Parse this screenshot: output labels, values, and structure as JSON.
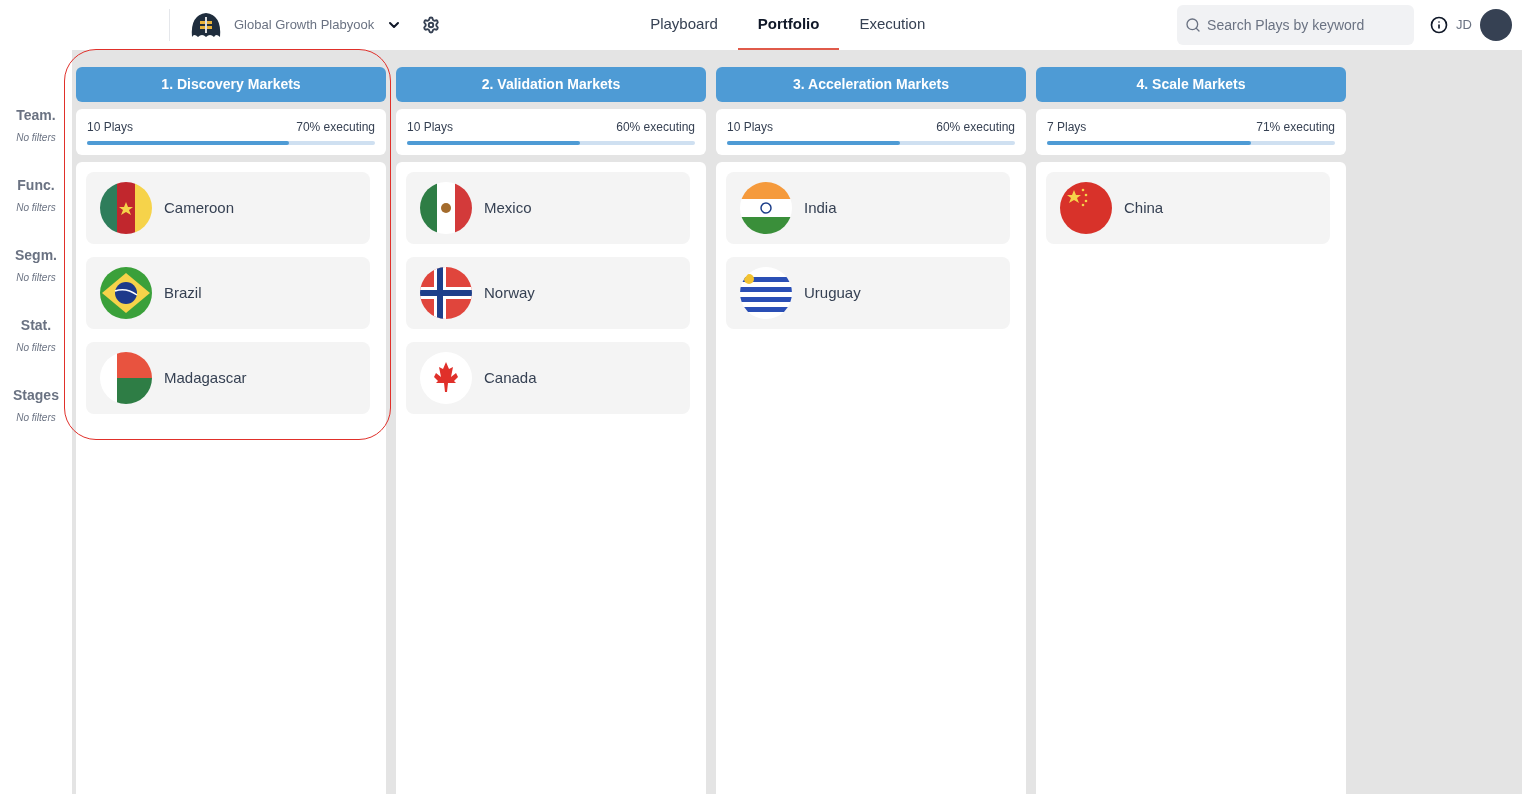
{
  "header": {
    "playbook": "Global Growth Plabyook",
    "tabs": [
      {
        "label": "Playboard",
        "selected": false
      },
      {
        "label": "Portfolio",
        "selected": true
      },
      {
        "label": "Execution",
        "selected": false
      }
    ],
    "search": {
      "placeholder": "Search Plays by keyword"
    },
    "user_initials": "JD"
  },
  "filters": [
    {
      "label": "Team.",
      "value": "No filters"
    },
    {
      "label": "Func.",
      "value": "No filters"
    },
    {
      "label": "Segm.",
      "value": "No filters"
    },
    {
      "label": "Stat.",
      "value": "No filters"
    },
    {
      "label": "Stages",
      "value": "No filters"
    }
  ],
  "columns": [
    {
      "title": "1. Discovery Markets",
      "plays": "10 Plays",
      "executing": "70% executing",
      "level": 0.7,
      "highlighted": true,
      "markets": [
        {
          "name": "Cameroon",
          "kind": "cameroon"
        },
        {
          "name": "Brazil",
          "kind": "brazil"
        },
        {
          "name": "Madagascar",
          "kind": "madagascar"
        }
      ]
    },
    {
      "title": "2. Validation Markets",
      "plays": "10 Plays",
      "executing": "60% executing",
      "level": 0.6,
      "highlighted": false,
      "markets": [
        {
          "name": "Mexico",
          "kind": "mexico"
        },
        {
          "name": "Norway",
          "kind": "norway"
        },
        {
          "name": "Canada",
          "kind": "canada"
        }
      ]
    },
    {
      "title": "3. Acceleration Markets",
      "plays": "10 Plays",
      "executing": "60% executing",
      "level": 0.6,
      "highlighted": false,
      "markets": [
        {
          "name": "India",
          "kind": "india"
        },
        {
          "name": "Uruguay",
          "kind": "uruguay"
        }
      ]
    },
    {
      "title": "4. Scale Markets",
      "plays": "7 Plays",
      "executing": "71% executing",
      "level": 0.71,
      "highlighted": false,
      "markets": [
        {
          "name": "China",
          "kind": "china"
        }
      ]
    }
  ]
}
